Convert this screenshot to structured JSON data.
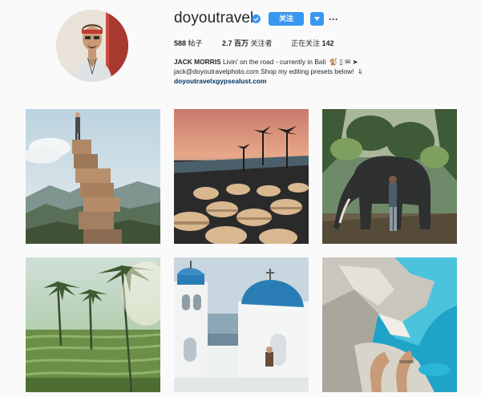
{
  "profile": {
    "username": "doyoutravel",
    "follow_label": "关注",
    "more_label": "···",
    "stats": {
      "posts_count": "588",
      "posts_label": "帖子",
      "followers_count": "2.7 百万",
      "followers_label": "关注者",
      "following_label": "正在关注",
      "following_count": "142"
    },
    "bio": {
      "full_name": "JACK MORRIS",
      "line1": "Livin' on the road - currently in Bali",
      "line1_glyphs": "🐒 ▯ ✉ ➤",
      "line2": "jack@doyoutravelphoto.com Shop my editing presets below!",
      "line2_glyph": "⇓",
      "link": "doyoutravelxgypsealust.com"
    }
  },
  "icons": {
    "verified": "verified-badge-icon",
    "dropdown": "chevron-down-icon",
    "more": "more-options-icon"
  },
  "colors": {
    "accent": "#3897f0",
    "link": "#003569",
    "background": "#fafafa",
    "text": "#262626"
  },
  "posts": [
    {
      "icon": "stacked-rocks-mountain-photo"
    },
    {
      "icon": "beach-club-sunset-photo"
    },
    {
      "icon": "elephant-jungle-photo"
    },
    {
      "icon": "rice-terraces-palms-photo"
    },
    {
      "icon": "santorini-blue-dome-photo"
    },
    {
      "icon": "navagio-beach-feet-photo"
    }
  ]
}
